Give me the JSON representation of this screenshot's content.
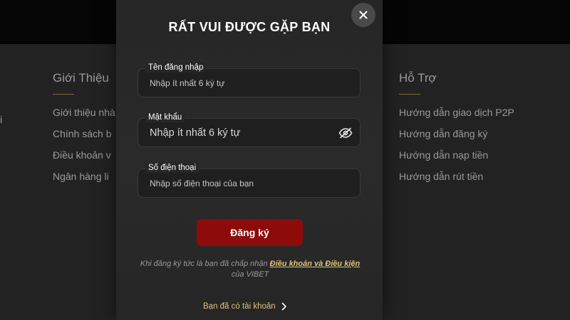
{
  "background": {
    "left_column": {
      "heading": "Giới Thiệu",
      "links": [
        "Giới thiệu nhà",
        "Chính sách b",
        "Điều khoản v",
        "Ngân hàng li"
      ]
    },
    "right_column": {
      "heading": "Hỗ Trợ",
      "links": [
        "Hướng dẫn giao dịch P2P",
        "Hướng dẫn đăng ký",
        "Hướng dẫn nạp tiền",
        "Hướng dẫn rút tiền"
      ]
    },
    "edge_fragment": "i"
  },
  "modal": {
    "title": "RẤT VUI ĐƯỢC GẶP BẠN",
    "close_icon": "close-icon",
    "fields": [
      {
        "label": "Tên đăng nhập",
        "placeholder": "Nhập ít nhất 6 ký tự",
        "value": ""
      },
      {
        "label": "Mật khẩu",
        "placeholder": "Nhập ít nhất 6 ký tự",
        "value": "",
        "icon": "eye-off-icon"
      },
      {
        "label": "Số điện thoại",
        "placeholder": "Nhập số điện thoại của bạn",
        "value": ""
      }
    ],
    "submit_label": "Đăng ký",
    "terms_prefix": "Khi đăng ký tức là bạn đã chấp nhận",
    "terms_link": "Điều khoản và Điều kiện",
    "terms_suffix": "của VIBET",
    "login_label": "Bạn đã có tài khoản",
    "login_icon": "chevron-right-icon"
  },
  "colors": {
    "accent_red": "#8e0b0b",
    "gold_link": "#e0c27a",
    "modal_bg": "#262626",
    "page_bg": "#222222"
  }
}
